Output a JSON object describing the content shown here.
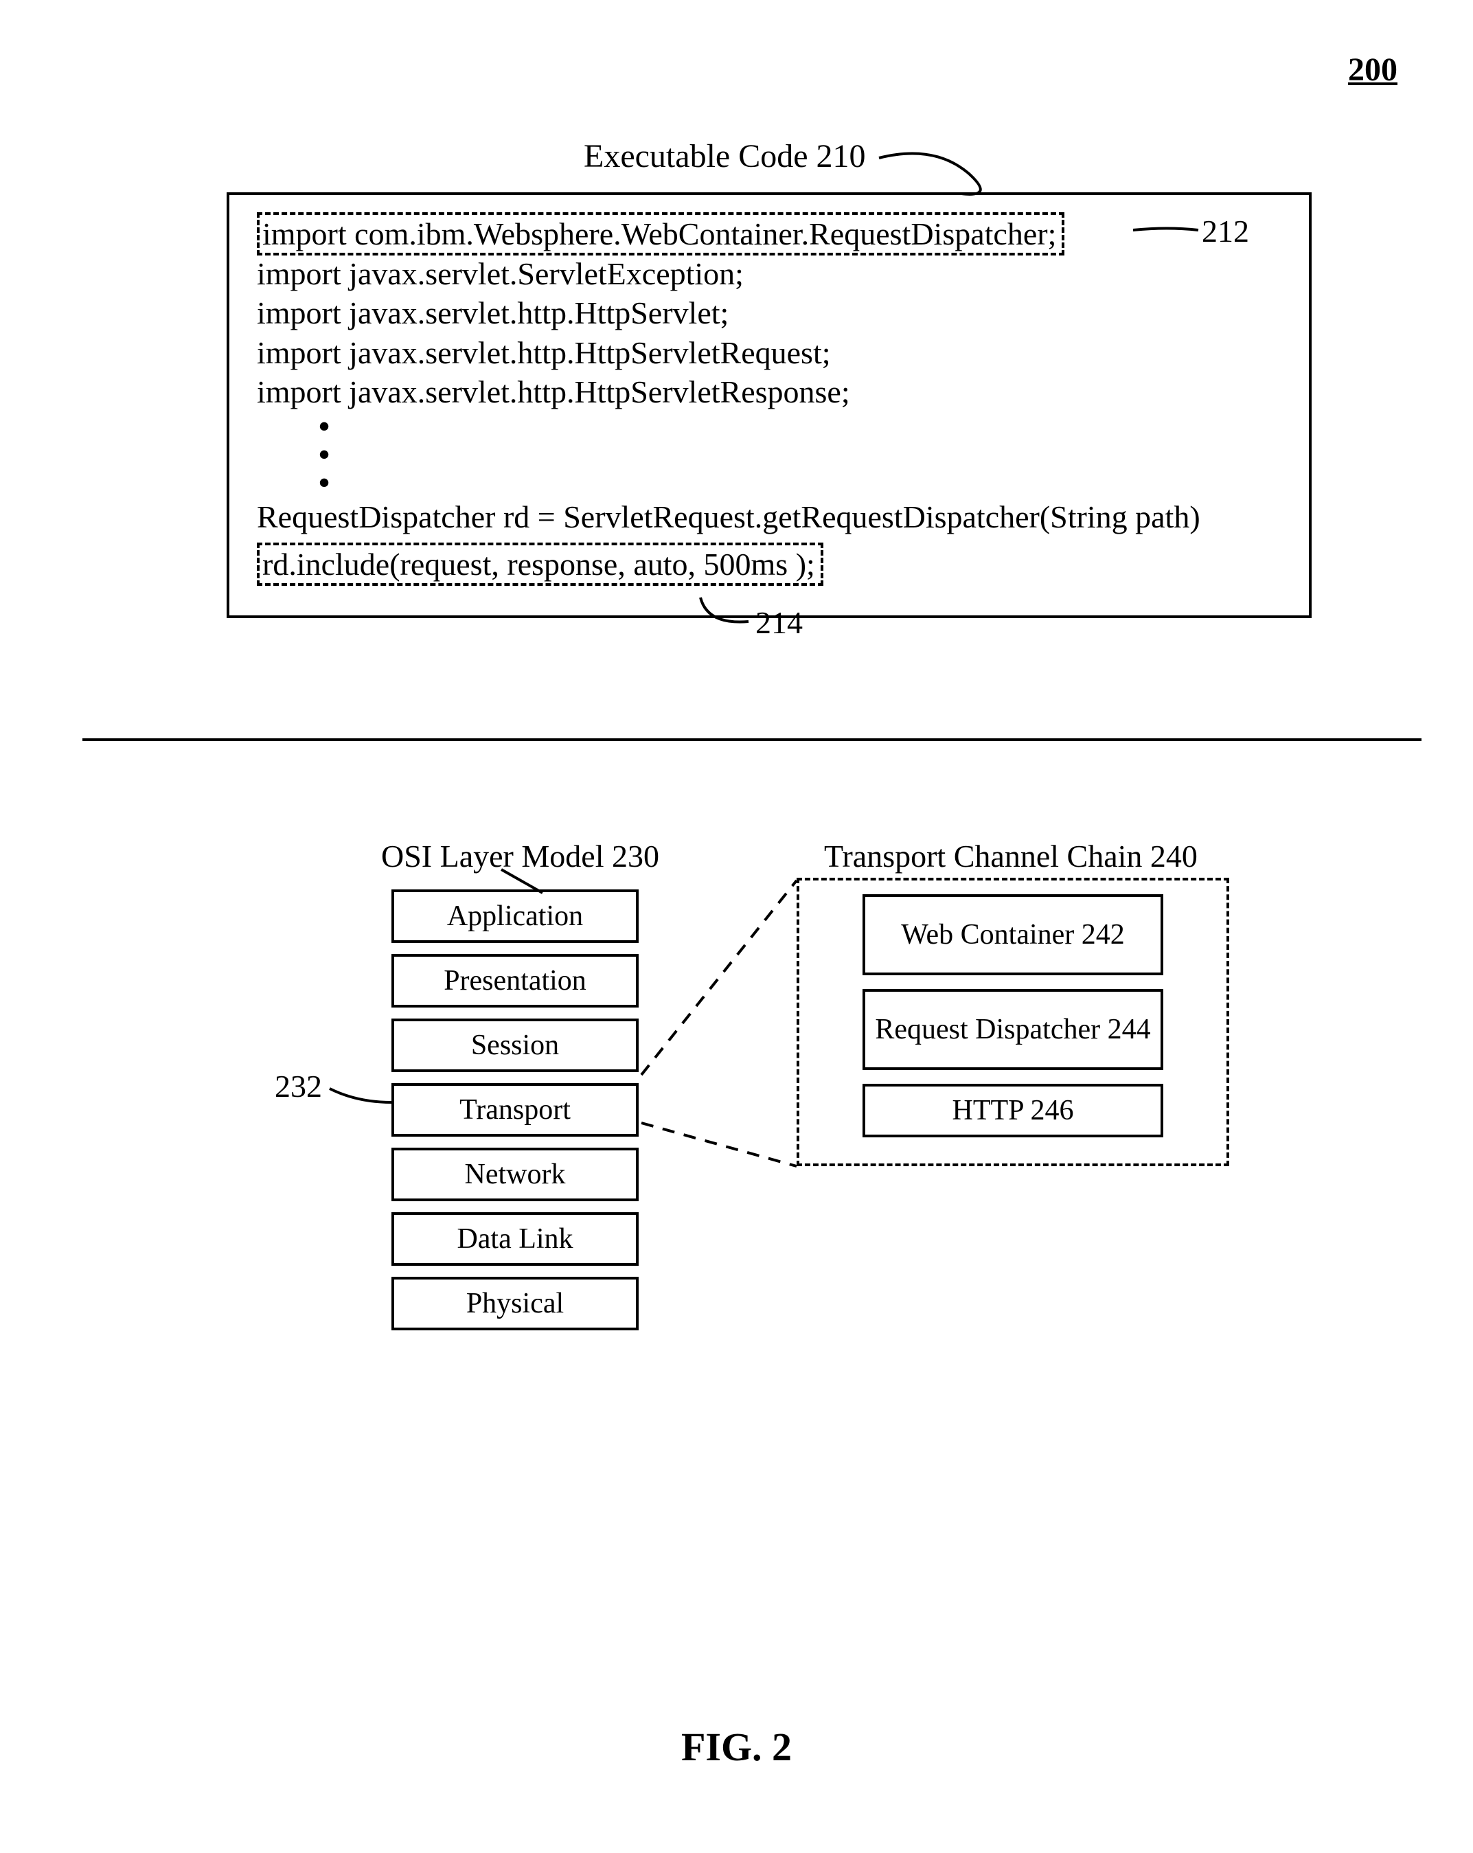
{
  "figure_ref": "200",
  "exec_code_title": "Executable Code 210",
  "ref_212": "212",
  "ref_214": "214",
  "code": {
    "line1": "import com.ibm.Websphere.WebContainer.RequestDispatcher;",
    "line2": "import javax.servlet.ServletException;",
    "line3": "import javax.servlet.http.HttpServlet;",
    "line4": "import javax.servlet.http.HttpServletRequest;",
    "line5": "import javax.servlet.http.HttpServletResponse;",
    "line6": "RequestDispatcher rd = ServletRequest.getRequestDispatcher(String path)",
    "line7": "rd.include(request, response,  auto, 500ms );"
  },
  "osi": {
    "title": "OSI Layer Model 230",
    "layers": {
      "l0": "Application",
      "l1": "Presentation",
      "l2": "Session",
      "l3": "Transport",
      "l4": "Network",
      "l5": "Data Link",
      "l6": "Physical"
    },
    "ref_232": "232"
  },
  "tcc": {
    "title": "Transport Channel Chain 240",
    "b0": "Web Container 242",
    "b1": "Request Dispatcher 244",
    "b2": "HTTP 246"
  },
  "fig_caption": "FIG. 2"
}
